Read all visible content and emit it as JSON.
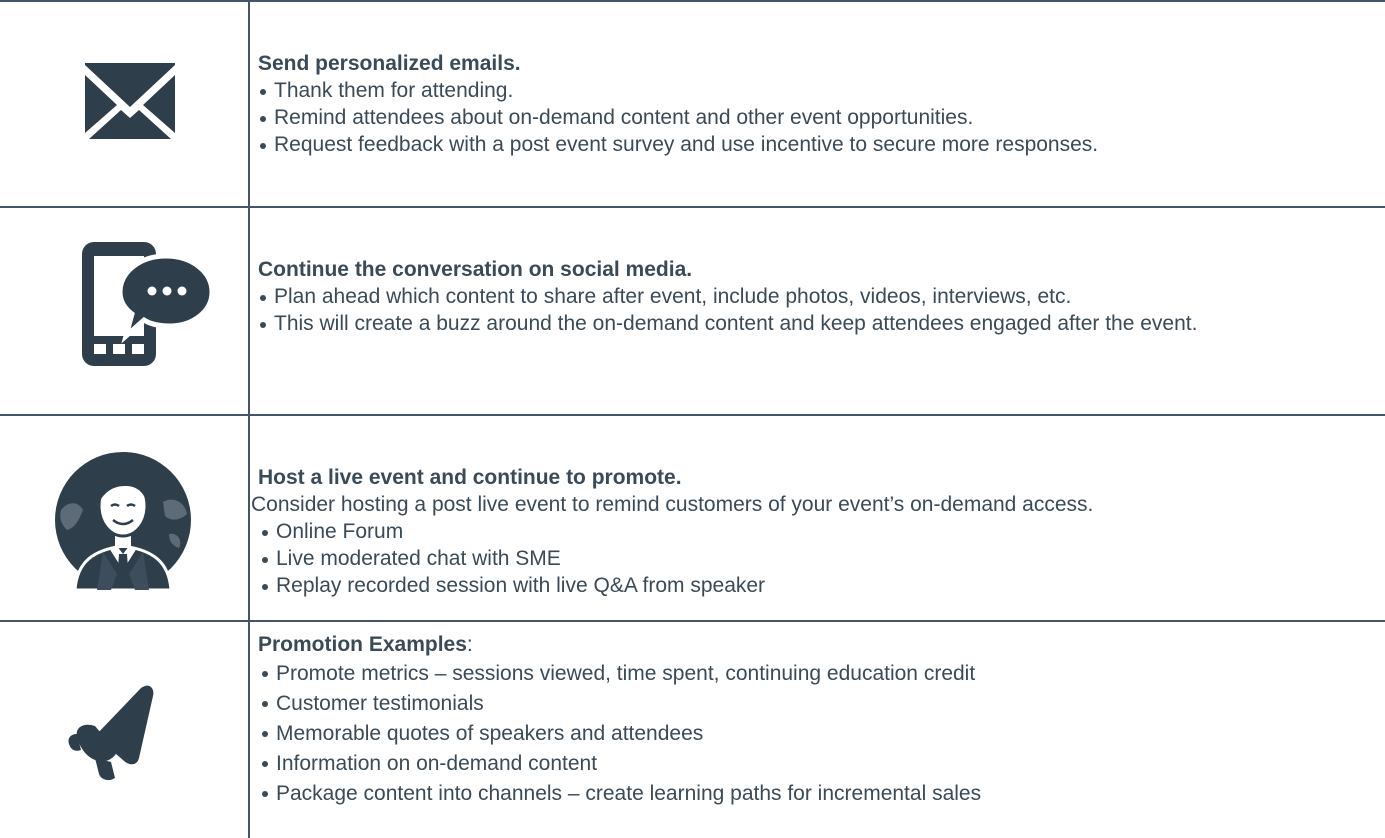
{
  "sections": [
    {
      "icon": "envelope-icon",
      "heading": "Send personalized emails.",
      "bullets": [
        "Thank them for attending.",
        "Remind attendees about on-demand content and other event opportunities.",
        "Request feedback with a post event survey and use incentive to secure more responses."
      ]
    },
    {
      "icon": "mobile-chat-icon",
      "heading": "Continue the conversation on social media.",
      "bullets": [
        "Plan ahead which content to share after event, include photos, videos, interviews, etc.",
        "This will create a buzz around the on-demand content and keep attendees engaged after the event."
      ]
    },
    {
      "icon": "speaker-globe-icon",
      "heading": "Host a live event and continue to promote.",
      "intro": "Consider hosting a post live event to remind customers of your event’s on-demand access.",
      "bullets": [
        "Online Forum",
        "Live moderated chat with SME",
        "Replay recorded session with live Q&A from speaker"
      ]
    },
    {
      "icon": "megaphone-icon",
      "heading": "Promotion Examples",
      "heading_suffix": ":",
      "bullets": [
        "Promote metrics – sessions viewed, time spent, continuing education credit",
        "Customer testimonials",
        "Memorable quotes of speakers and attendees",
        "Information on on-demand content",
        "Package content into channels – create learning paths for incremental sales"
      ]
    }
  ],
  "colors": {
    "icon": "#2f3e4b",
    "rule": "#44546a",
    "text": "#3a4a57"
  }
}
